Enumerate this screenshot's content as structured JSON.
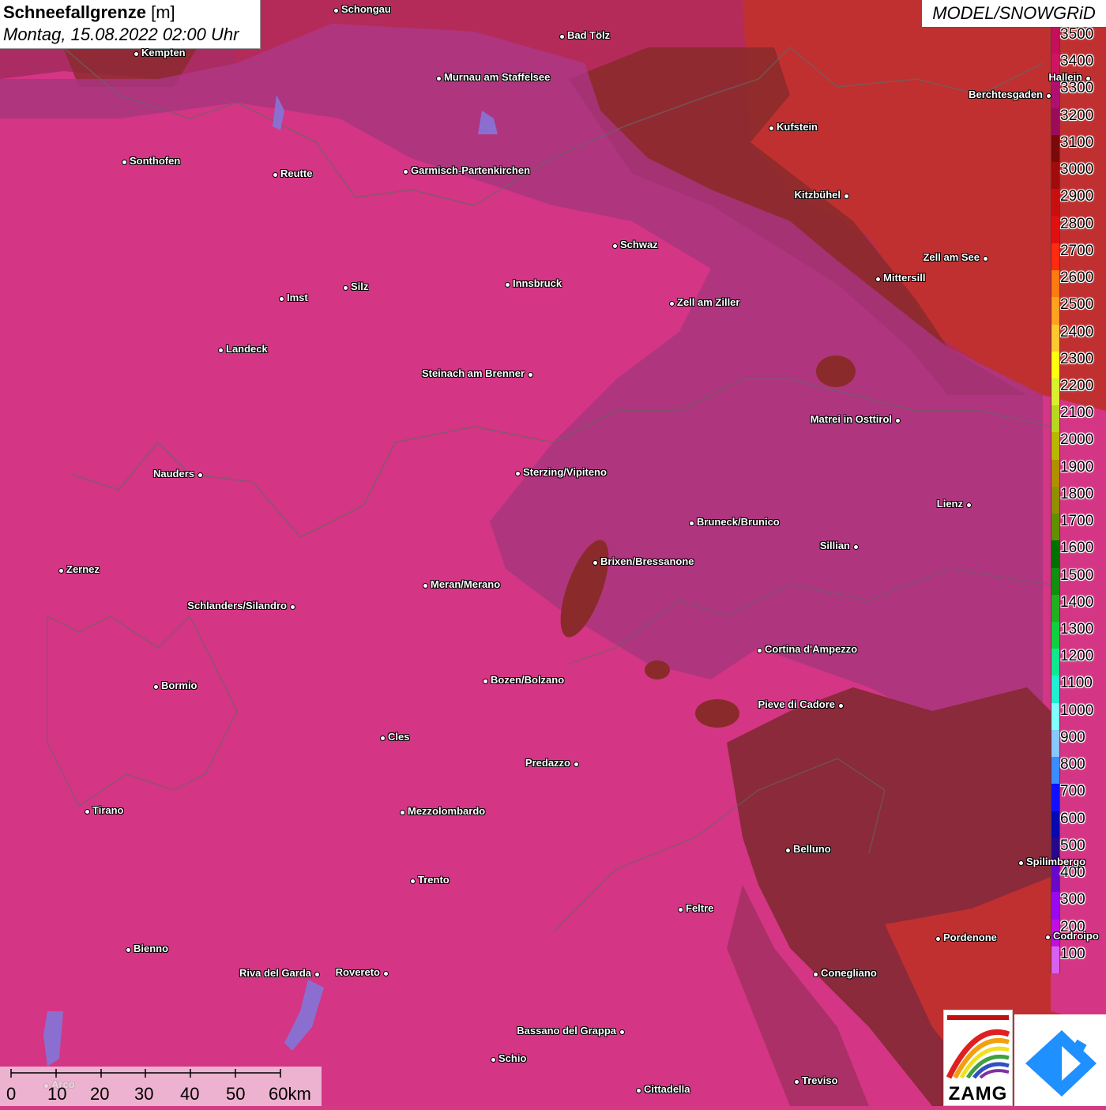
{
  "title": {
    "main": "Schneefallgrenze",
    "unit": "[m]",
    "datetime": "Montag, 15.08.2022 02:00 Uhr"
  },
  "model": "MODEL/SNOWGRiD",
  "legend": {
    "labels": [
      "3500",
      "3400",
      "3300",
      "3200",
      "3100",
      "3000",
      "2900",
      "2800",
      "2700",
      "2600",
      "2500",
      "2400",
      "2300",
      "2200",
      "2100",
      "2000",
      "1900",
      "1800",
      "1700",
      "1600",
      "1500",
      "1400",
      "1300",
      "1200",
      "1100",
      "1000",
      "900",
      "800",
      "700",
      "600",
      "500",
      "400",
      "300",
      "200",
      "100"
    ],
    "colors": [
      "#c2105c",
      "#d01464",
      "#b00f72",
      "#9a0c5a",
      "#7a0a0a",
      "#a00c0c",
      "#c80f0f",
      "#e01010",
      "#ff2a10",
      "#ff7a10",
      "#ffa020",
      "#ffc830",
      "#ffff10",
      "#d8f030",
      "#b8d820",
      "#b8b800",
      "#b09000",
      "#909000",
      "#609000",
      "#007000",
      "#109010",
      "#20b020",
      "#10d040",
      "#10e890",
      "#20f0d0",
      "#80ffff",
      "#88c8ff",
      "#3a8cff",
      "#1010ff",
      "#0808b0",
      "#280888",
      "#6808c8",
      "#9808f0",
      "#c010e0",
      "#d860f0"
    ]
  },
  "scale": {
    "labels": [
      "0",
      "10",
      "20",
      "30",
      "40",
      "50",
      "60km"
    ]
  },
  "logo": {
    "text": "ZAMG"
  },
  "cities": [
    {
      "name": "Schongau",
      "label_side": "right"
    },
    {
      "name": "Bad Tölz",
      "label_side": "right"
    },
    {
      "name": "Kempten",
      "label_side": "right"
    },
    {
      "name": "Murnau am Staffelsee",
      "label_side": "right"
    },
    {
      "name": "Hallein",
      "label_side": "left"
    },
    {
      "name": "Berchtesgaden",
      "label_side": "left"
    },
    {
      "name": "Kufstein",
      "label_side": "right"
    },
    {
      "name": "Sonthofen",
      "label_side": "right"
    },
    {
      "name": "Reutte",
      "label_side": "right"
    },
    {
      "name": "Garmisch-Partenkirchen",
      "label_side": "right"
    },
    {
      "name": "Kitzbühel",
      "label_side": "left"
    },
    {
      "name": "Schwaz",
      "label_side": "right"
    },
    {
      "name": "Zell am See",
      "label_side": "left"
    },
    {
      "name": "Mittersill",
      "label_side": "right"
    },
    {
      "name": "Innsbruck",
      "label_side": "right"
    },
    {
      "name": "Silz",
      "label_side": "right"
    },
    {
      "name": "Imst",
      "label_side": "right"
    },
    {
      "name": "Zell am Ziller",
      "label_side": "right"
    },
    {
      "name": "Landeck",
      "label_side": "right"
    },
    {
      "name": "Steinach am Brenner",
      "label_side": "left"
    },
    {
      "name": "Matrei in Osttirol",
      "label_side": "left"
    },
    {
      "name": "Nauders",
      "label_side": "left"
    },
    {
      "name": "Sterzing/Vipiteno",
      "label_side": "right"
    },
    {
      "name": "Lienz",
      "label_side": "left"
    },
    {
      "name": "Bruneck/Brunico",
      "label_side": "right"
    },
    {
      "name": "Sillian",
      "label_side": "left"
    },
    {
      "name": "Brixen/Bressanone",
      "label_side": "right"
    },
    {
      "name": "Zernez",
      "label_side": "right"
    },
    {
      "name": "Meran/Merano",
      "label_side": "right"
    },
    {
      "name": "Schlanders/Silandro",
      "label_side": "left"
    },
    {
      "name": "Cortina d'Ampezzo",
      "label_side": "right"
    },
    {
      "name": "Bozen/Bolzano",
      "label_side": "right"
    },
    {
      "name": "Bormio",
      "label_side": "right"
    },
    {
      "name": "Pieve di Cadore",
      "label_side": "left"
    },
    {
      "name": "Cles",
      "label_side": "right"
    },
    {
      "name": "Predazzo",
      "label_side": "left"
    },
    {
      "name": "Tirano",
      "label_side": "right"
    },
    {
      "name": "Mezzolombardo",
      "label_side": "right"
    },
    {
      "name": "Belluno",
      "label_side": "right"
    },
    {
      "name": "Spilimbergo",
      "label_side": "right"
    },
    {
      "name": "Trento",
      "label_side": "right"
    },
    {
      "name": "Feltre",
      "label_side": "right"
    },
    {
      "name": "Pordenone",
      "label_side": "right"
    },
    {
      "name": "Codroipo",
      "label_side": "right"
    },
    {
      "name": "Bienno",
      "label_side": "right"
    },
    {
      "name": "Riva del Garda",
      "label_side": "left"
    },
    {
      "name": "Rovereto",
      "label_side": "left"
    },
    {
      "name": "Conegliano",
      "label_side": "right"
    },
    {
      "name": "Bassano del Grappa",
      "label_side": "left"
    },
    {
      "name": "Schio",
      "label_side": "right"
    },
    {
      "name": "Treviso",
      "label_side": "right"
    },
    {
      "name": "Cittadella",
      "label_side": "right"
    },
    {
      "name": "Arco",
      "label_side": "right"
    }
  ]
}
